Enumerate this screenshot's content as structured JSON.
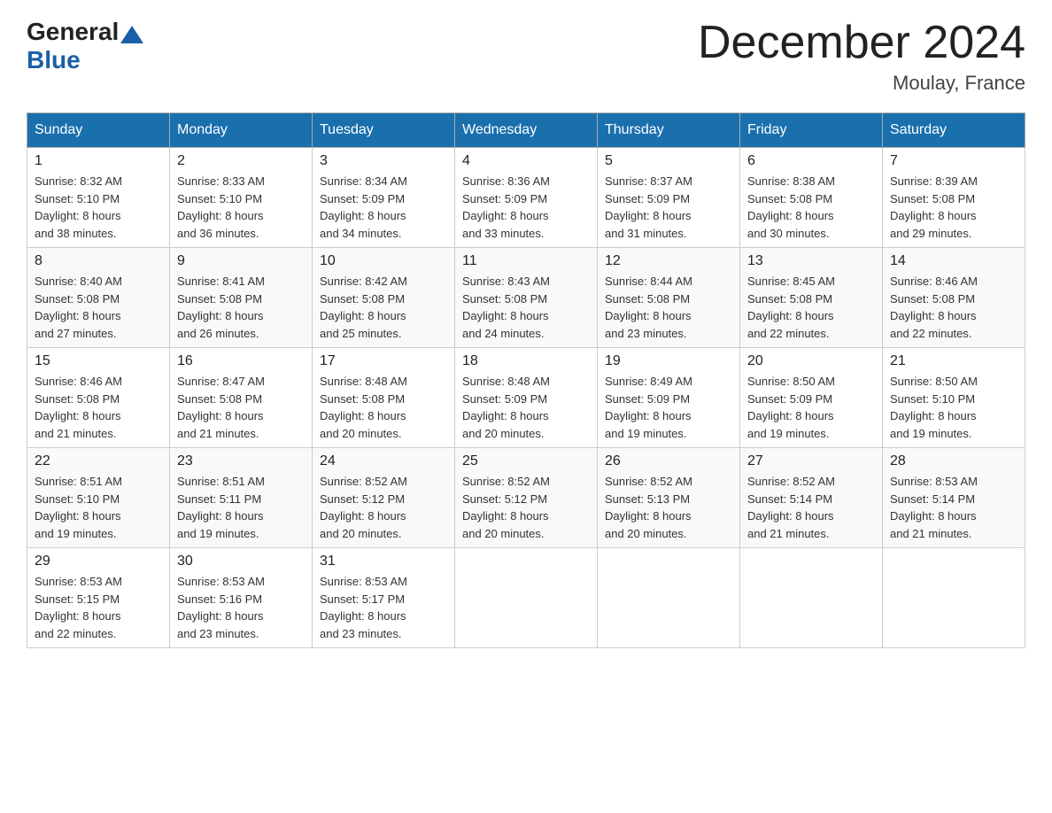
{
  "header": {
    "title": "December 2024",
    "location": "Moulay, France",
    "logo_general": "General",
    "logo_blue": "Blue"
  },
  "days_of_week": [
    "Sunday",
    "Monday",
    "Tuesday",
    "Wednesday",
    "Thursday",
    "Friday",
    "Saturday"
  ],
  "weeks": [
    [
      {
        "day": "1",
        "sunrise": "8:32 AM",
        "sunset": "5:10 PM",
        "daylight": "8 hours and 38 minutes."
      },
      {
        "day": "2",
        "sunrise": "8:33 AM",
        "sunset": "5:10 PM",
        "daylight": "8 hours and 36 minutes."
      },
      {
        "day": "3",
        "sunrise": "8:34 AM",
        "sunset": "5:09 PM",
        "daylight": "8 hours and 34 minutes."
      },
      {
        "day": "4",
        "sunrise": "8:36 AM",
        "sunset": "5:09 PM",
        "daylight": "8 hours and 33 minutes."
      },
      {
        "day": "5",
        "sunrise": "8:37 AM",
        "sunset": "5:09 PM",
        "daylight": "8 hours and 31 minutes."
      },
      {
        "day": "6",
        "sunrise": "8:38 AM",
        "sunset": "5:08 PM",
        "daylight": "8 hours and 30 minutes."
      },
      {
        "day": "7",
        "sunrise": "8:39 AM",
        "sunset": "5:08 PM",
        "daylight": "8 hours and 29 minutes."
      }
    ],
    [
      {
        "day": "8",
        "sunrise": "8:40 AM",
        "sunset": "5:08 PM",
        "daylight": "8 hours and 27 minutes."
      },
      {
        "day": "9",
        "sunrise": "8:41 AM",
        "sunset": "5:08 PM",
        "daylight": "8 hours and 26 minutes."
      },
      {
        "day": "10",
        "sunrise": "8:42 AM",
        "sunset": "5:08 PM",
        "daylight": "8 hours and 25 minutes."
      },
      {
        "day": "11",
        "sunrise": "8:43 AM",
        "sunset": "5:08 PM",
        "daylight": "8 hours and 24 minutes."
      },
      {
        "day": "12",
        "sunrise": "8:44 AM",
        "sunset": "5:08 PM",
        "daylight": "8 hours and 23 minutes."
      },
      {
        "day": "13",
        "sunrise": "8:45 AM",
        "sunset": "5:08 PM",
        "daylight": "8 hours and 22 minutes."
      },
      {
        "day": "14",
        "sunrise": "8:46 AM",
        "sunset": "5:08 PM",
        "daylight": "8 hours and 22 minutes."
      }
    ],
    [
      {
        "day": "15",
        "sunrise": "8:46 AM",
        "sunset": "5:08 PM",
        "daylight": "8 hours and 21 minutes."
      },
      {
        "day": "16",
        "sunrise": "8:47 AM",
        "sunset": "5:08 PM",
        "daylight": "8 hours and 21 minutes."
      },
      {
        "day": "17",
        "sunrise": "8:48 AM",
        "sunset": "5:08 PM",
        "daylight": "8 hours and 20 minutes."
      },
      {
        "day": "18",
        "sunrise": "8:48 AM",
        "sunset": "5:09 PM",
        "daylight": "8 hours and 20 minutes."
      },
      {
        "day": "19",
        "sunrise": "8:49 AM",
        "sunset": "5:09 PM",
        "daylight": "8 hours and 19 minutes."
      },
      {
        "day": "20",
        "sunrise": "8:50 AM",
        "sunset": "5:09 PM",
        "daylight": "8 hours and 19 minutes."
      },
      {
        "day": "21",
        "sunrise": "8:50 AM",
        "sunset": "5:10 PM",
        "daylight": "8 hours and 19 minutes."
      }
    ],
    [
      {
        "day": "22",
        "sunrise": "8:51 AM",
        "sunset": "5:10 PM",
        "daylight": "8 hours and 19 minutes."
      },
      {
        "day": "23",
        "sunrise": "8:51 AM",
        "sunset": "5:11 PM",
        "daylight": "8 hours and 19 minutes."
      },
      {
        "day": "24",
        "sunrise": "8:52 AM",
        "sunset": "5:12 PM",
        "daylight": "8 hours and 20 minutes."
      },
      {
        "day": "25",
        "sunrise": "8:52 AM",
        "sunset": "5:12 PM",
        "daylight": "8 hours and 20 minutes."
      },
      {
        "day": "26",
        "sunrise": "8:52 AM",
        "sunset": "5:13 PM",
        "daylight": "8 hours and 20 minutes."
      },
      {
        "day": "27",
        "sunrise": "8:52 AM",
        "sunset": "5:14 PM",
        "daylight": "8 hours and 21 minutes."
      },
      {
        "day": "28",
        "sunrise": "8:53 AM",
        "sunset": "5:14 PM",
        "daylight": "8 hours and 21 minutes."
      }
    ],
    [
      {
        "day": "29",
        "sunrise": "8:53 AM",
        "sunset": "5:15 PM",
        "daylight": "8 hours and 22 minutes."
      },
      {
        "day": "30",
        "sunrise": "8:53 AM",
        "sunset": "5:16 PM",
        "daylight": "8 hours and 23 minutes."
      },
      {
        "day": "31",
        "sunrise": "8:53 AM",
        "sunset": "5:17 PM",
        "daylight": "8 hours and 23 minutes."
      },
      null,
      null,
      null,
      null
    ]
  ]
}
